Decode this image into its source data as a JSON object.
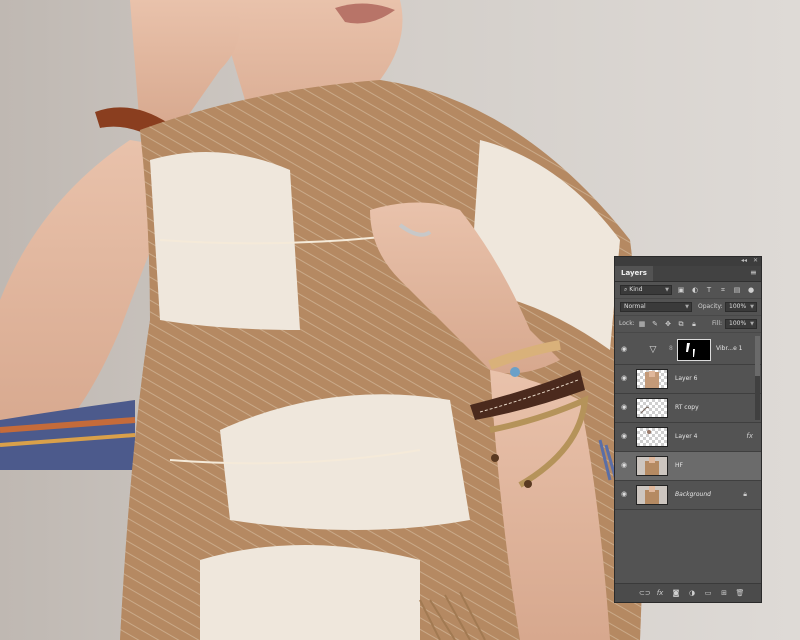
{
  "panel": {
    "tab_label": "Layers",
    "collapse_glyph": "◂◂",
    "close_glyph": "✕",
    "menu_glyph": "≡",
    "filter": {
      "value": "Kind",
      "icon": "search-icon"
    },
    "blend_mode": "Normal",
    "opacity_label": "Opacity:",
    "opacity_value": "100%",
    "lock_label": "Lock:",
    "fill_label": "Fill:",
    "fill_value": "100%",
    "layers": [
      {
        "name": "Vibr...e 1",
        "type": "adjustment",
        "visible": true
      },
      {
        "name": "Layer 6",
        "type": "pixel",
        "visible": true
      },
      {
        "name": "RT copy",
        "type": "pixel",
        "visible": true
      },
      {
        "name": "Layer 4",
        "type": "pixel",
        "visible": true,
        "fx": "fx"
      },
      {
        "name": "HF",
        "type": "pixel",
        "visible": true,
        "selected": true
      },
      {
        "name": "Background",
        "type": "background",
        "visible": true,
        "locked": true
      }
    ]
  },
  "colors": {
    "panel_bg": "#535353",
    "selected_row": "#6b6b6b",
    "photo_bg": "#cdc8c3",
    "scarf_tan": "#b58a62",
    "scarf_cream": "#efe7dc",
    "skin": "#e2b8a0"
  }
}
